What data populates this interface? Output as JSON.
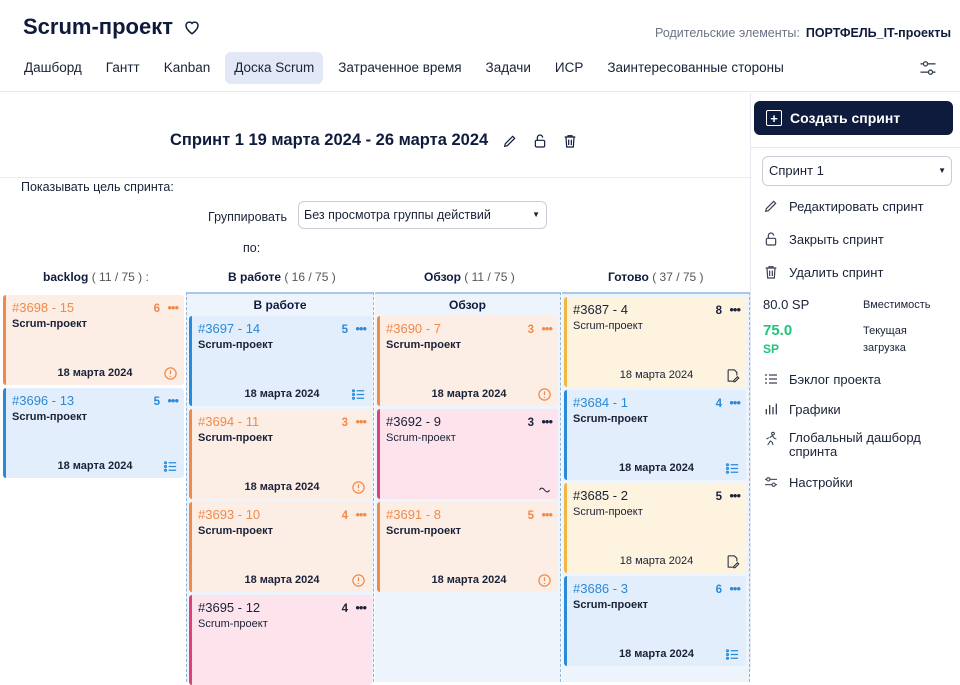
{
  "header": {
    "title": "Scrum-проект",
    "parent_label": "Родительские элементы:",
    "parent_value": "ПОРТФЕЛЬ_IT-проекты",
    "tabs": [
      "Дашборд",
      "Гантт",
      "Kanban",
      "Доска Scrum",
      "Затраченное время",
      "Задачи",
      "ИСР",
      "Заинтересованные стороны"
    ],
    "active_tab": "Доска Scrum"
  },
  "sprint": {
    "title": "Спринт 1 19 марта 2024 - 26 марта 2024",
    "show_goal_label": "Показывать цель спринта:",
    "group_label_1": "Группировать",
    "group_label_2": "по:",
    "group_value": "Без просмотра группы действий"
  },
  "columns": [
    {
      "name": "backlog",
      "count": "( 11 / 75 ) :"
    },
    {
      "name": "В работе",
      "count": "( 16 / 75 )"
    },
    {
      "name": "Обзор",
      "count": "( 11 / 75 )"
    },
    {
      "name": "Готово",
      "count": "( 37 / 75 )"
    }
  ],
  "subheaders": {
    "in_work": "В работе",
    "review": "Обзор"
  },
  "cards": {
    "c3698": {
      "num": "#3698 - 15",
      "pts": "6",
      "proj": "Scrum-проект",
      "date": "18 марта 2024"
    },
    "c3696": {
      "num": "#3696 - 13",
      "pts": "5",
      "proj": "Scrum-проект",
      "date": "18 марта 2024"
    },
    "c3697": {
      "num": "#3697 - 14",
      "pts": "5",
      "proj": "Scrum-проект",
      "date": "18 марта 2024"
    },
    "c3694": {
      "num": "#3694 - 11",
      "pts": "3",
      "proj": "Scrum-проект",
      "date": "18 марта 2024"
    },
    "c3693": {
      "num": "#3693 - 10",
      "pts": "4",
      "proj": "Scrum-проект",
      "date": "18 марта 2024"
    },
    "c3695": {
      "num": "#3695 - 12",
      "pts": "4",
      "proj": "Scrum-проект"
    },
    "c3690": {
      "num": "#3690 - 7",
      "pts": "3",
      "proj": "Scrum-проект",
      "date": "18 марта 2024"
    },
    "c3692": {
      "num": "#3692 - 9",
      "pts": "3",
      "proj": "Scrum-проект"
    },
    "c3691": {
      "num": "#3691 - 8",
      "pts": "5",
      "proj": "Scrum-проект",
      "date": "18 марта 2024"
    },
    "c3687": {
      "num": "#3687 - 4",
      "pts": "8",
      "proj": "Scrum-проект",
      "date": "18 марта 2024"
    },
    "c3684": {
      "num": "#3684 - 1",
      "pts": "4",
      "proj": "Scrum-проект",
      "date": "18 марта 2024"
    },
    "c3685": {
      "num": "#3685 - 2",
      "pts": "5",
      "proj": "Scrum-проект",
      "date": "18 марта 2024"
    },
    "c3686": {
      "num": "#3686 - 3",
      "pts": "6",
      "proj": "Scrum-проект",
      "date": "18 марта 2024"
    }
  },
  "sidebar": {
    "create": "Создать спринт",
    "sprint_select": "Спринт 1",
    "edit": "Редактировать спринт",
    "close": "Закрыть спринт",
    "delete": "Удалить спринт",
    "capacity_val": "80.0 SP",
    "capacity_lbl": "Вместимость",
    "load_val": "75.0",
    "load_unit": "SP",
    "load_lbl_1": "Текущая",
    "load_lbl_2": "загрузка",
    "backlog": "Бэклог проекта",
    "charts": "Графики",
    "global_1": "Глобальный дашборд",
    "global_2": "спринта",
    "settings": "Настройки"
  }
}
